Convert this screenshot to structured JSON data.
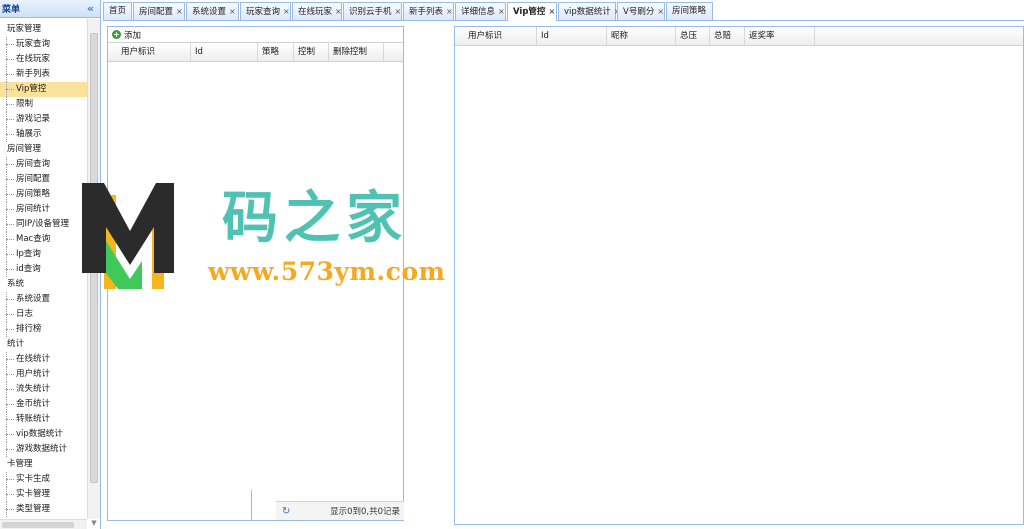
{
  "sidebar": {
    "title": "菜单",
    "collapse_icon": "double-chevron-left-icon",
    "tree": [
      {
        "label": "玩家管理",
        "type": "group"
      },
      {
        "label": "玩家查询",
        "type": "leaf"
      },
      {
        "label": "在线玩家",
        "type": "leaf"
      },
      {
        "label": "新手列表",
        "type": "leaf"
      },
      {
        "label": "Vip管控",
        "type": "leaf",
        "active": true
      },
      {
        "label": "限制",
        "type": "leaf"
      },
      {
        "label": "游戏记录",
        "type": "leaf"
      },
      {
        "label": "轴展示",
        "type": "leaf"
      },
      {
        "label": "房间管理",
        "type": "group"
      },
      {
        "label": "房间查询",
        "type": "leaf"
      },
      {
        "label": "房间配置",
        "type": "leaf"
      },
      {
        "label": "房间策略",
        "type": "leaf"
      },
      {
        "label": "房间统计",
        "type": "leaf"
      },
      {
        "label": "同IP/设备管理",
        "type": "leaf"
      },
      {
        "label": "Mac查询",
        "type": "leaf"
      },
      {
        "label": "Ip查询",
        "type": "leaf"
      },
      {
        "label": "id查询",
        "type": "leaf"
      },
      {
        "label": "系统",
        "type": "group"
      },
      {
        "label": "系统设置",
        "type": "leaf"
      },
      {
        "label": "日志",
        "type": "leaf"
      },
      {
        "label": "排行榜",
        "type": "leaf"
      },
      {
        "label": "统计",
        "type": "group"
      },
      {
        "label": "在线统计",
        "type": "leaf"
      },
      {
        "label": "用户统计",
        "type": "leaf"
      },
      {
        "label": "流失统计",
        "type": "leaf"
      },
      {
        "label": "金币统计",
        "type": "leaf"
      },
      {
        "label": "转账统计",
        "type": "leaf"
      },
      {
        "label": "vip数据统计",
        "type": "leaf"
      },
      {
        "label": "游戏数据统计",
        "type": "leaf"
      },
      {
        "label": "卡管理",
        "type": "group"
      },
      {
        "label": "实卡生成",
        "type": "leaf"
      },
      {
        "label": "实卡管理",
        "type": "leaf"
      },
      {
        "label": "类型管理",
        "type": "leaf"
      }
    ]
  },
  "tabs": [
    {
      "label": "首页",
      "closable": false
    },
    {
      "label": "房间配置",
      "closable": true
    },
    {
      "label": "系统设置",
      "closable": true
    },
    {
      "label": "玩家查询",
      "closable": true
    },
    {
      "label": "在线玩家",
      "closable": true
    },
    {
      "label": "识别云手机",
      "closable": true
    },
    {
      "label": "新手列表",
      "closable": true
    },
    {
      "label": "详细信息",
      "closable": true
    },
    {
      "label": "Vip管控",
      "closable": true,
      "active": true
    },
    {
      "label": "vip数据统计",
      "closable": true
    },
    {
      "label": "V号刷分",
      "closable": true
    },
    {
      "label": "房间策略",
      "closable": false
    }
  ],
  "left_panel": {
    "add_label": "添加",
    "columns": [
      "用户标识",
      "Id",
      "策略",
      "控制",
      "删除控制"
    ],
    "pager_text": "显示0到0,共0记录"
  },
  "right_panel": {
    "columns": [
      "用户标识",
      "Id",
      "昵称",
      "总压",
      "总赔",
      "返奖率"
    ]
  },
  "watermark": {
    "title": "码之家",
    "url": "www.573ym.com",
    "colors": {
      "title": "#4fc2b3",
      "url": "#f4a921",
      "logo_dark": "#2b2b2b",
      "logo_green": "#3ec95a",
      "logo_yellow": "#f5b51c"
    }
  },
  "colors": {
    "border": "#99bbe8",
    "active_tree_item": "#fbe29a",
    "header_text": "#15428b"
  }
}
